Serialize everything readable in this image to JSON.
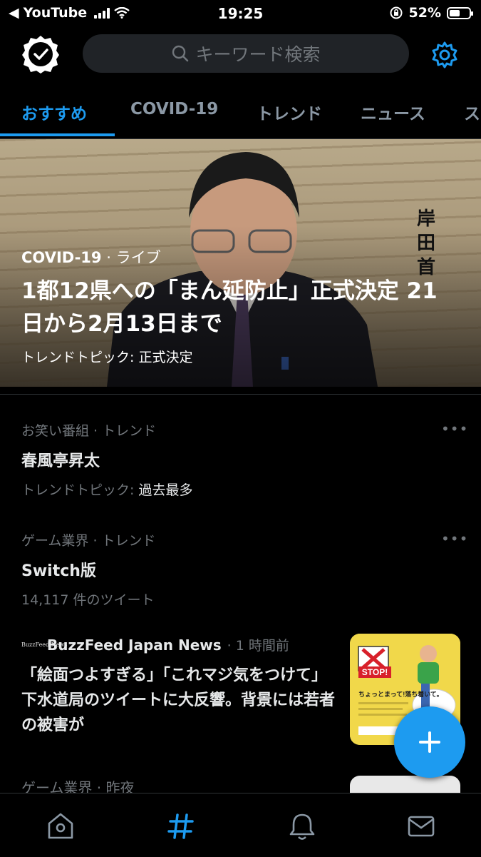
{
  "status_bar": {
    "back_app": "YouTube",
    "time": "19:25",
    "battery": "52%",
    "battery_level": 0.52
  },
  "search": {
    "placeholder": "キーワード検索"
  },
  "tabs": [
    {
      "label": "おすすめ",
      "active": true
    },
    {
      "label": "COVID-19",
      "active": false
    },
    {
      "label": "トレンド",
      "active": false
    },
    {
      "label": "ニュース",
      "active": false
    },
    {
      "label": "ス",
      "active": false
    }
  ],
  "hero": {
    "category": "COVID-19",
    "tag": "· ライブ",
    "title": "1都12県への「まん延防止」正式決定 21日から2月13日まで",
    "subtitle": "トレンドトピック: 正式決定",
    "vertical_caption": "岸田首"
  },
  "trends": [
    {
      "meta": "お笑い番組 · トレンド",
      "name": "春風亭昇太",
      "sub_label": "トレンドトピック:",
      "sub_value": "過去最多"
    },
    {
      "meta": "ゲーム業界 · トレンド",
      "name": "Switch版",
      "sub_label": "14,117 件のツイート",
      "sub_value": ""
    }
  ],
  "news": {
    "logo_text": "BuzzFeed News",
    "source": "BuzzFeed Japan News",
    "time": "· 1 時間前",
    "headline": "「絵面つよすぎる」「これマジ気をつけて」下水道局のツイートに大反響。背景には若者の被害が",
    "thumb": {
      "stop": "STOP!",
      "caption": "ちょっとまって!落ち着いて。"
    }
  },
  "partial_item": {
    "meta": "ゲーム業界 · 昨夜"
  },
  "colors": {
    "accent": "#1d9bf0",
    "background": "#000000",
    "muted_text": "#71767b"
  },
  "icons": {
    "verify": "verified-badge-icon",
    "settings": "gear-icon",
    "compose": "plus-icon",
    "nav": [
      "home-icon",
      "explore-hashtag-icon",
      "notifications-bell-icon",
      "messages-envelope-icon"
    ]
  }
}
